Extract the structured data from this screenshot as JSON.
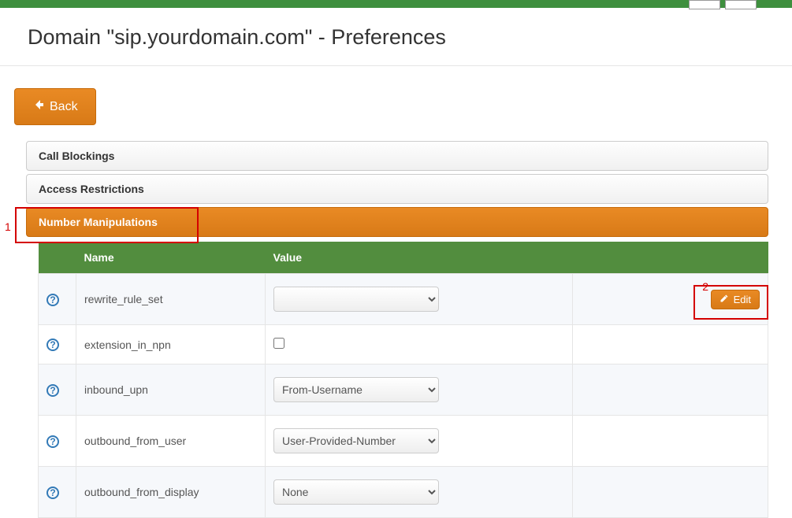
{
  "page_title": "Domain \"sip.yourdomain.com\" - Preferences",
  "back_button": "Back",
  "accordion": {
    "call_blockings": "Call Blockings",
    "access_restrictions": "Access Restrictions",
    "number_manipulations": "Number Manipulations"
  },
  "table": {
    "headers": {
      "name": "Name",
      "value": "Value"
    },
    "rows": [
      {
        "name": "rewrite_rule_set",
        "value": "",
        "control": "select",
        "edit_label": "Edit"
      },
      {
        "name": "extension_in_npn",
        "value": "",
        "control": "checkbox"
      },
      {
        "name": "inbound_upn",
        "value": "From-Username",
        "control": "select"
      },
      {
        "name": "outbound_from_user",
        "value": "User-Provided-Number",
        "control": "select"
      },
      {
        "name": "outbound_from_display",
        "value": "None",
        "control": "select"
      }
    ]
  },
  "markers": {
    "one": "1",
    "two": "2"
  }
}
